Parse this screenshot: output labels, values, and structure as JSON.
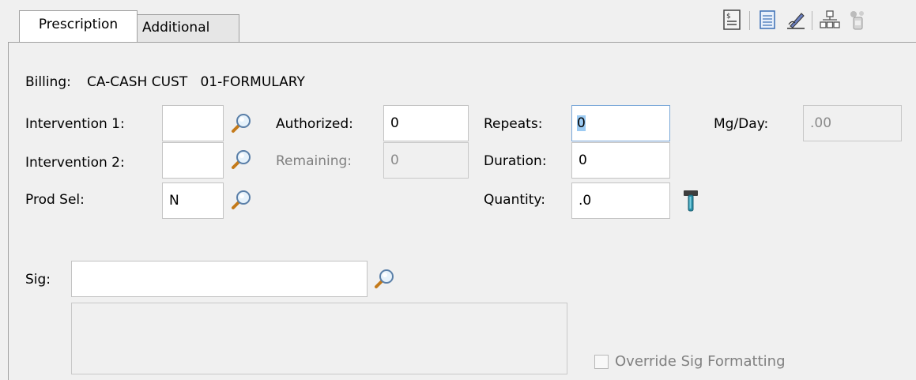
{
  "tabs": [
    {
      "label": "Prescription",
      "active": true
    },
    {
      "label": "Additional",
      "active": false
    }
  ],
  "toolbar": {
    "icons": [
      "document-icon",
      "notes-icon",
      "sign-pen-icon",
      "network-icon",
      "pill-bottle-icon"
    ]
  },
  "billing": {
    "label": "Billing:",
    "value": "CA-CASH CUST   01-FORMULARY"
  },
  "fields": {
    "intervention1": {
      "label": "Intervention 1:",
      "value": ""
    },
    "intervention2": {
      "label": "Intervention 2:",
      "value": ""
    },
    "prod_sel": {
      "label": "Prod Sel:",
      "value": "N"
    },
    "authorized": {
      "label": "Authorized:",
      "value": "0"
    },
    "remaining": {
      "label": "Remaining:",
      "value": "0"
    },
    "repeats": {
      "label": "Repeats:",
      "value": "0"
    },
    "duration": {
      "label": "Duration:",
      "value": "0"
    },
    "quantity": {
      "label": "Quantity:",
      "value": ".0"
    },
    "mg_day": {
      "label": "Mg/Day:",
      "value": ".00"
    },
    "sig": {
      "label": "Sig:",
      "value": ""
    },
    "sig_text": {
      "value": ""
    }
  },
  "override": {
    "label": "Override Sig Formatting",
    "checked": false
  }
}
